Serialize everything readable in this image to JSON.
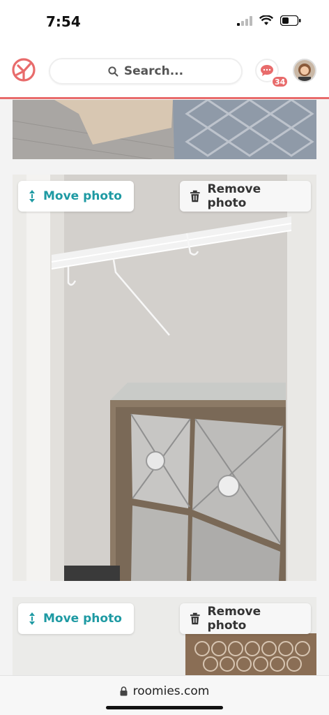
{
  "status": {
    "time": "7:54"
  },
  "header": {
    "search_placeholder": "Search...",
    "unread_count": "34"
  },
  "photos": [
    {
      "move_label": "Move photo",
      "remove_label": "Remove photo"
    },
    {
      "move_label": "Move photo",
      "remove_label": "Remove photo"
    }
  ],
  "browser": {
    "url": "roomies.com"
  },
  "colors": {
    "brand": "#e86b6b",
    "teal": "#1e9aa3"
  }
}
